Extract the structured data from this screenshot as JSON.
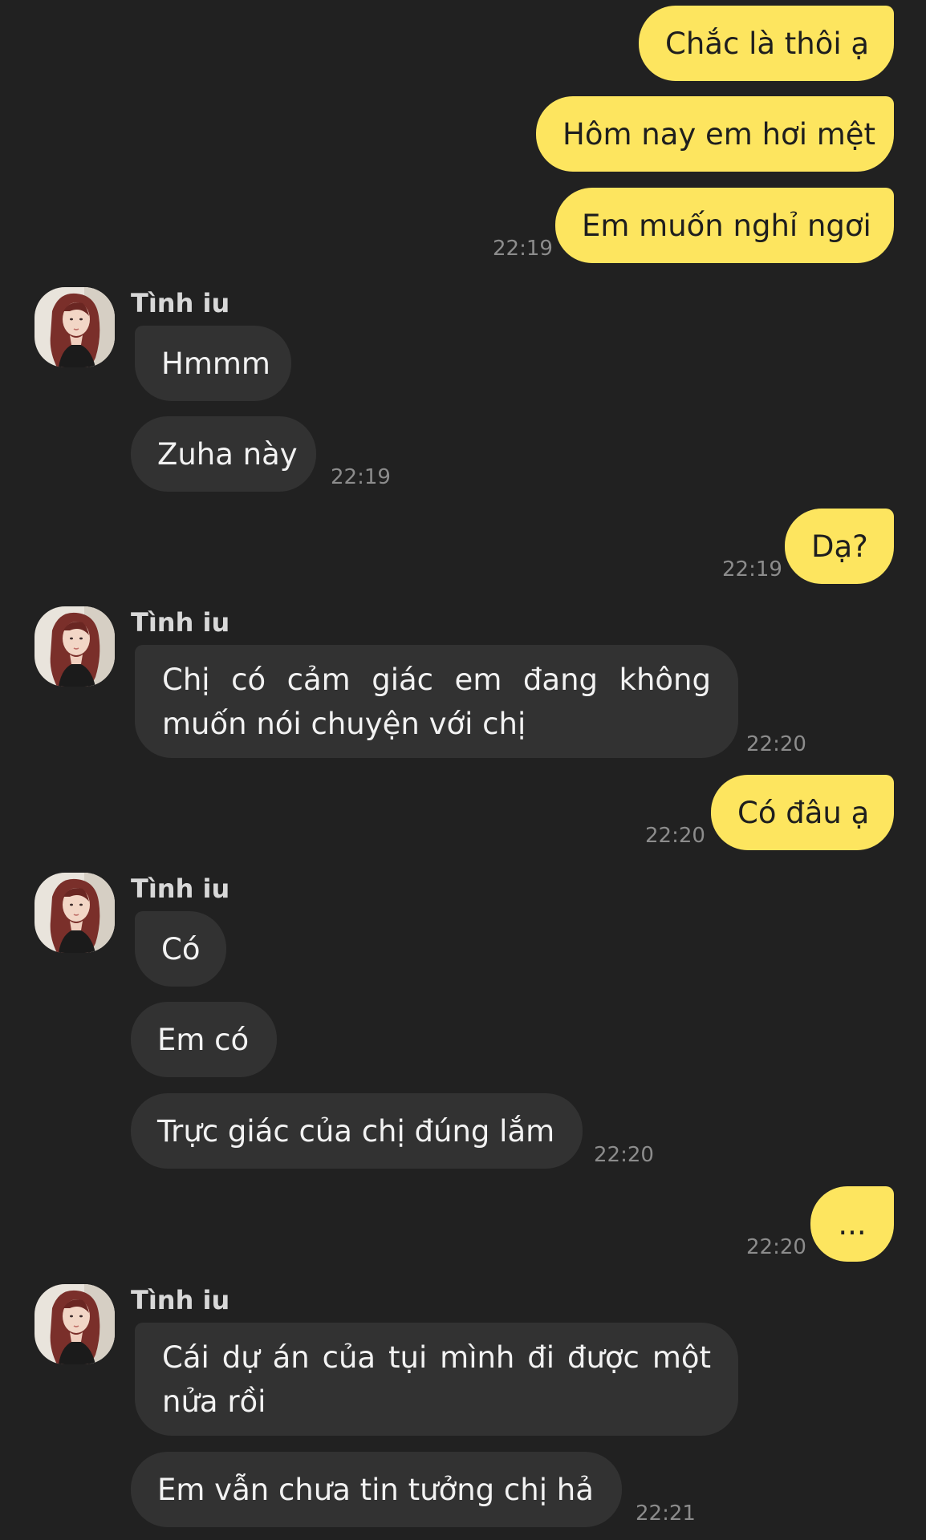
{
  "contact": {
    "name": "Tình iu"
  },
  "colors": {
    "background": "#212121",
    "outgoing_bubble": "#fde55f",
    "incoming_bubble": "#323232",
    "timestamp": "#8c8c8c"
  },
  "messages": [
    {
      "direction": "outgoing",
      "text": "Chắc là thôi ạ"
    },
    {
      "direction": "outgoing",
      "text": "Hôm nay em hơi mệt"
    },
    {
      "direction": "outgoing",
      "text": "Em muốn nghỉ ngơi",
      "time": "22:19"
    },
    {
      "direction": "incoming",
      "sender": "Tình iu",
      "text": "Hmmm"
    },
    {
      "direction": "incoming",
      "text": "Zuha này",
      "time": "22:19"
    },
    {
      "direction": "outgoing",
      "text": "Dạ?",
      "time": "22:19"
    },
    {
      "direction": "incoming",
      "sender": "Tình iu",
      "text": "Chị có cảm giác em đang không muốn nói chuyện với chị",
      "time": "22:20"
    },
    {
      "direction": "outgoing",
      "text": "Có đâu ạ",
      "time": "22:20"
    },
    {
      "direction": "incoming",
      "sender": "Tình iu",
      "text": "Có"
    },
    {
      "direction": "incoming",
      "text": "Em có"
    },
    {
      "direction": "incoming",
      "text": "Trực giác của chị đúng lắm",
      "time": "22:20"
    },
    {
      "direction": "outgoing",
      "text": "...",
      "time": "22:20"
    },
    {
      "direction": "incoming",
      "sender": "Tình iu",
      "text": "Cái dự án của tụi mình đi được một nửa rồi"
    },
    {
      "direction": "incoming",
      "text": "Em vẫn chưa tin tưởng chị hả",
      "time": "22:21"
    }
  ]
}
